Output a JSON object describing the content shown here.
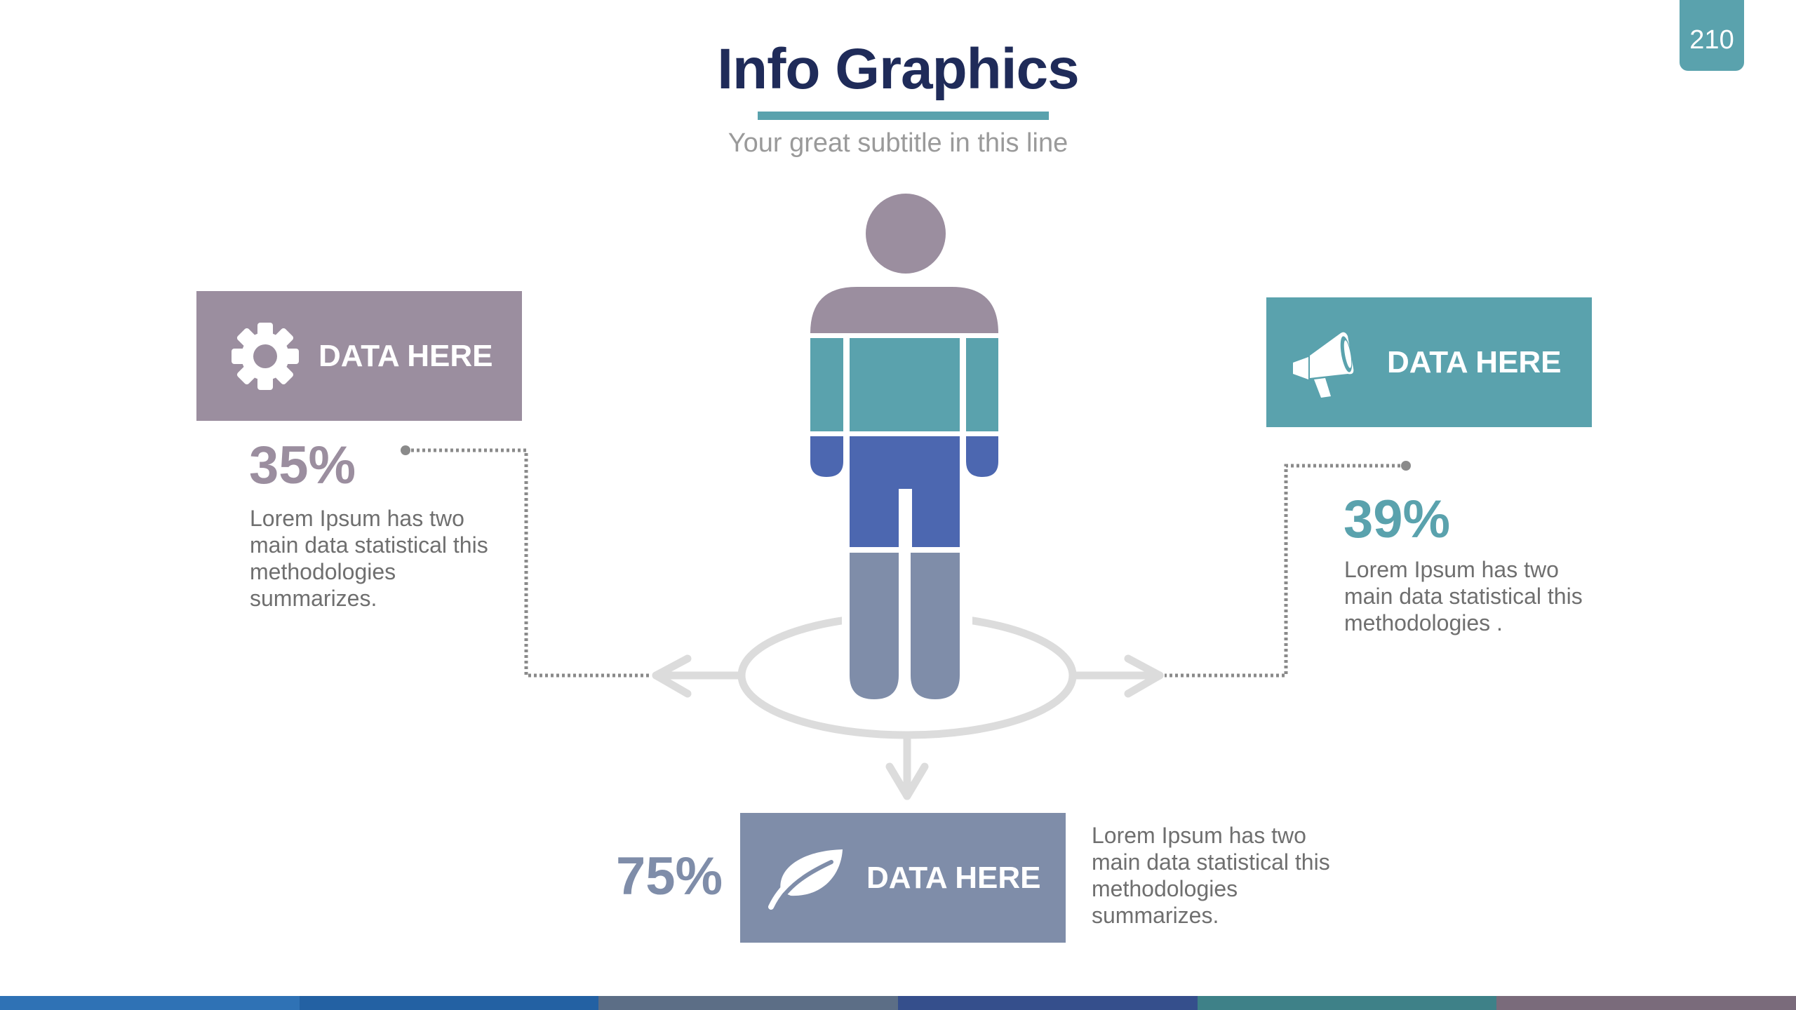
{
  "page_number": "210",
  "header": {
    "title": "Info Graphics",
    "subtitle": "Your great subtitle in this line"
  },
  "colors": {
    "navy": "#1f2b59",
    "teal": "#5aa2ad",
    "mauve": "#9b8e9f",
    "slate": "#7f8da9",
    "blue": "#4c67b0",
    "arrow_gray": "#dcdcdc",
    "dotted_gray": "#8a8a8a"
  },
  "figure": {
    "icon": "person-standing-icon"
  },
  "items": {
    "left": {
      "icon": "gear-icon",
      "label": "DATA HERE",
      "percent": "35%",
      "description": "Lorem Ipsum has two main data statistical this methodologies summarizes."
    },
    "right": {
      "icon": "megaphone-icon",
      "label": "DATA HERE",
      "percent": "39%",
      "description": "Lorem Ipsum has two main data statistical this methodologies ."
    },
    "bottom": {
      "icon": "leaf-icon",
      "label": "DATA HERE",
      "percent": "75%",
      "description": "Lorem Ipsum has two main data statistical this methodologies summarizes."
    }
  },
  "bottom_strip_colors": [
    "#2f72b5",
    "#2361a3",
    "#5c6e86",
    "#354f8c",
    "#3e8188",
    "#7a6b7b"
  ]
}
